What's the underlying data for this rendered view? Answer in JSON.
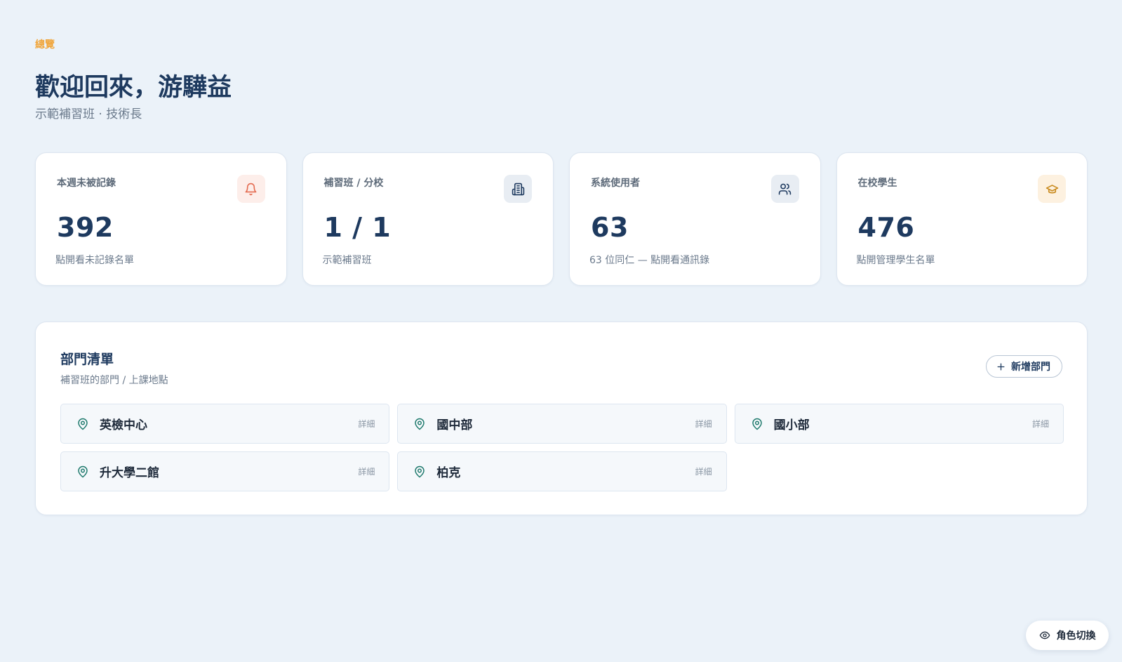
{
  "header": {
    "eyebrow": "總覽",
    "title": "歡迎回來，游驊益",
    "subtitle": "示範補習班 · 技術長"
  },
  "stats": [
    {
      "label": "本週未被記錄",
      "value": "392",
      "caption": "點開看未記錄名單",
      "icon": "bell-icon",
      "icon_bg": "#fdeeea",
      "icon_color": "#e46a4f"
    },
    {
      "label": "補習班 / 分校",
      "value": "1 / 1",
      "caption": "示範補習班",
      "icon": "building-icon",
      "icon_bg": "#e8edf3",
      "icon_color": "#1e3a5f"
    },
    {
      "label": "系統使用者",
      "value": "63",
      "caption": "63 位同仁 — 點開看通訊錄",
      "icon": "users-icon",
      "icon_bg": "#e8edf3",
      "icon_color": "#1e3a5f"
    },
    {
      "label": "在校學生",
      "value": "476",
      "caption": "點開管理學生名單",
      "icon": "graduation-cap-icon",
      "icon_bg": "#fdf1e0",
      "icon_color": "#c98a1e"
    }
  ],
  "departments": {
    "title": "部門清單",
    "subtitle": "補習班的部門 / 上課地點",
    "add_label": "新增部門",
    "items": [
      {
        "name": "英檢中心",
        "detail": "詳細"
      },
      {
        "name": "國中部",
        "detail": "詳細"
      },
      {
        "name": "國小部",
        "detail": "詳細"
      },
      {
        "name": "升大學二館",
        "detail": "詳細"
      },
      {
        "name": "柏克",
        "detail": "詳細"
      }
    ]
  },
  "role_switch": {
    "label": "角色切換",
    "icon": "eye-icon"
  },
  "colors": {
    "accent_orange": "#f0a53a",
    "primary_navy": "#1e3a5f",
    "pin_teal": "#1f7a6d",
    "background": "#ebf2f9"
  }
}
